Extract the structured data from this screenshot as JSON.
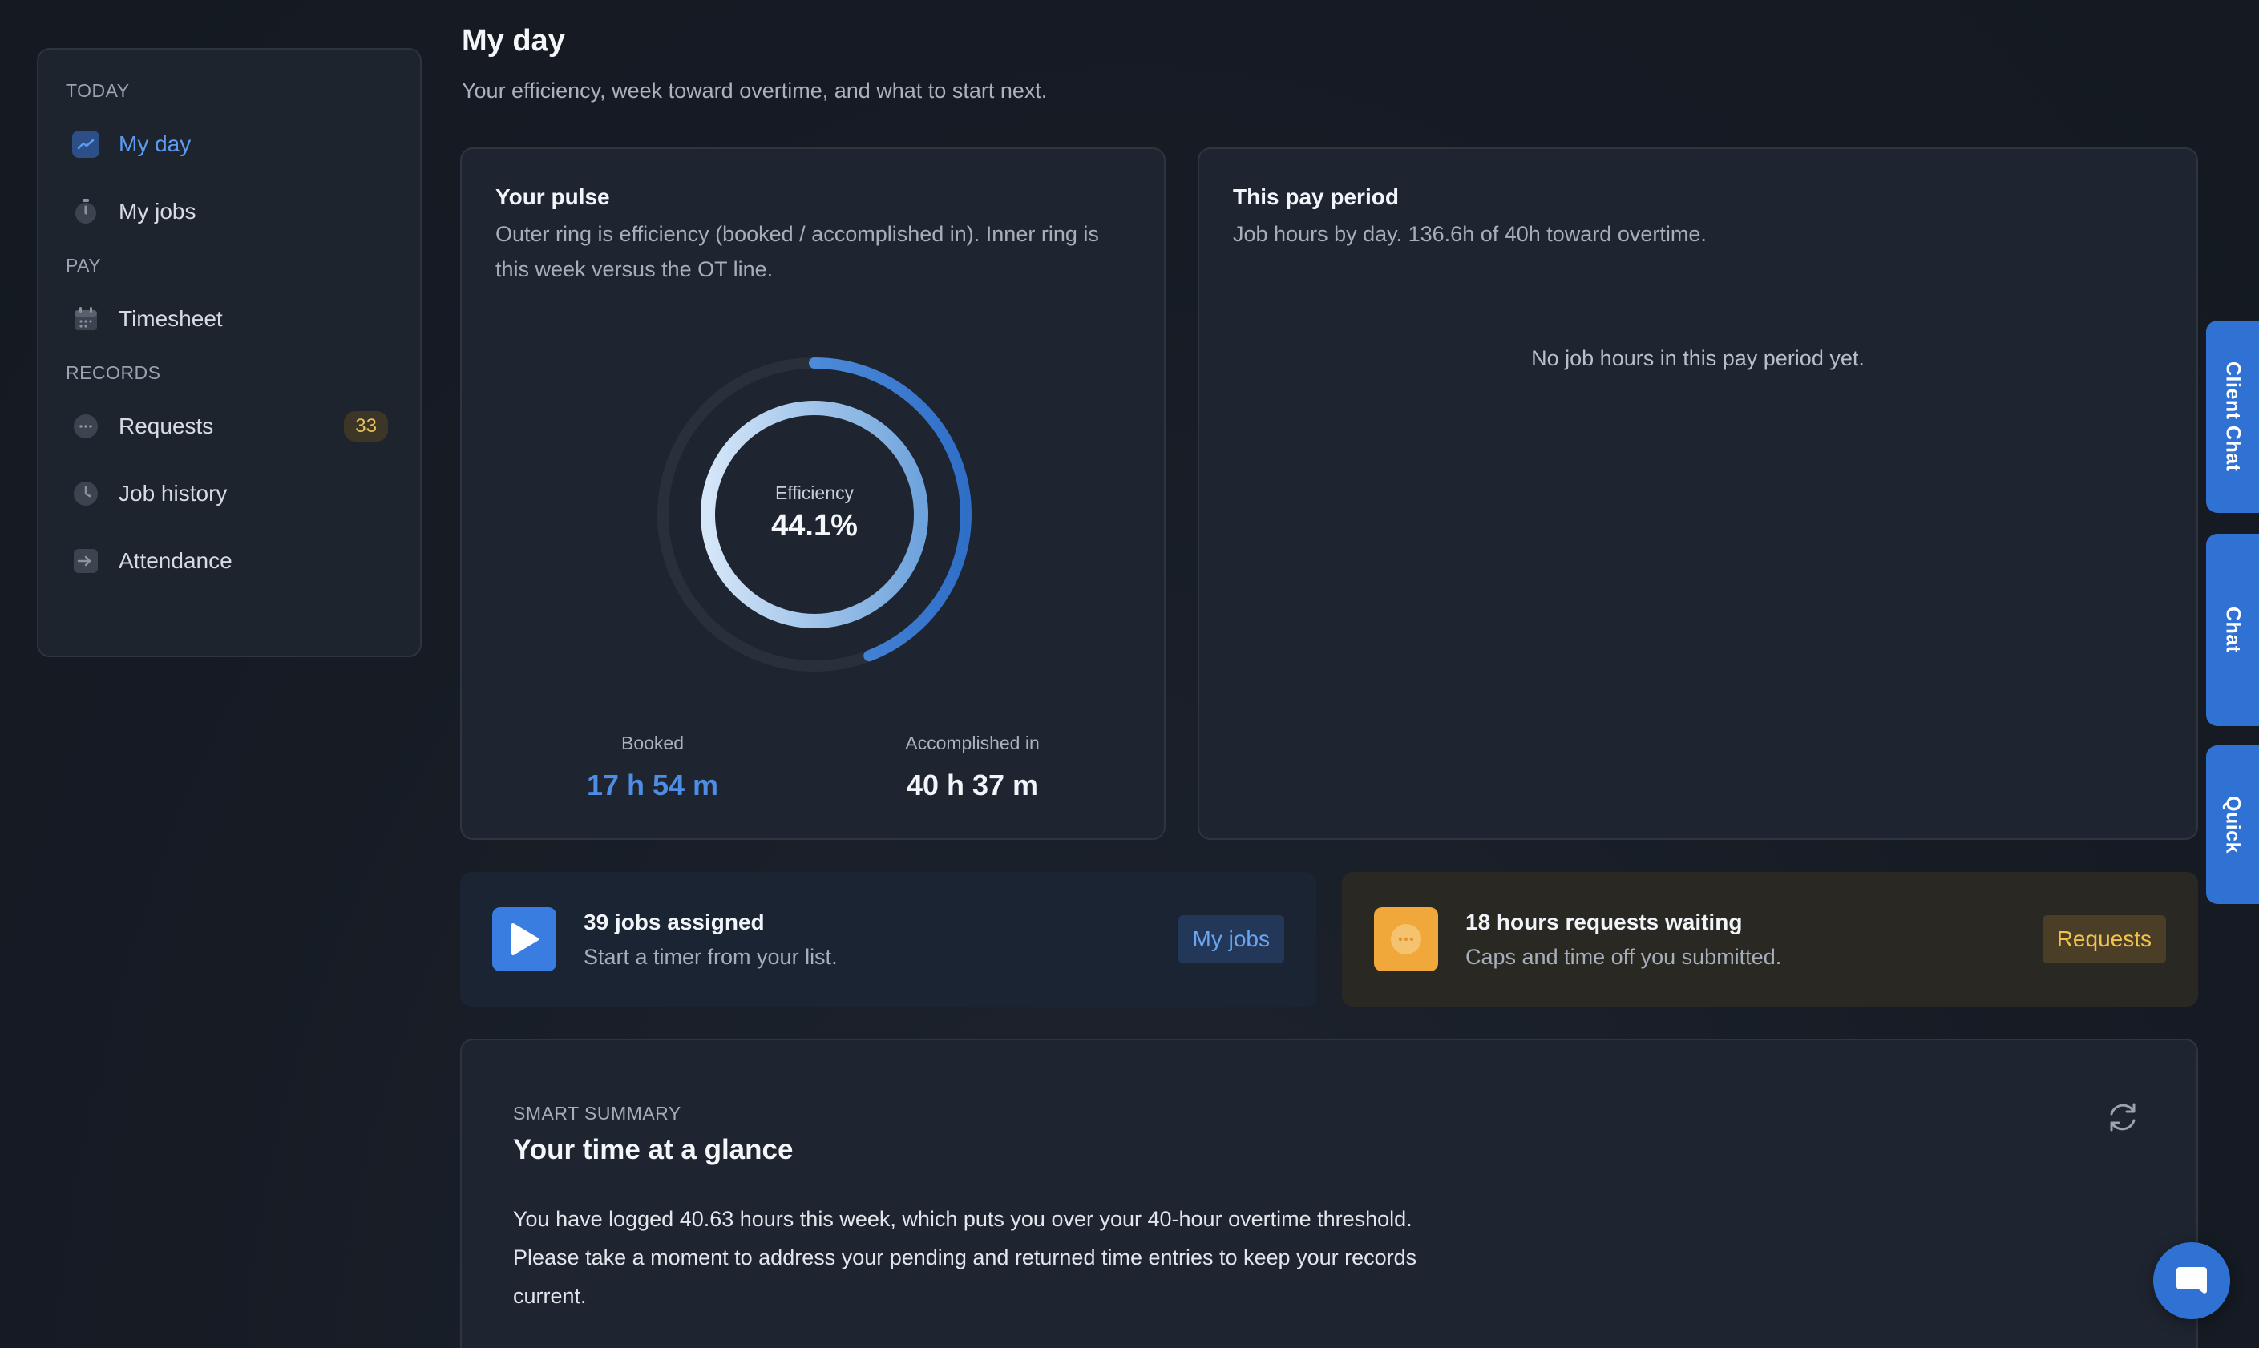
{
  "sidebar": {
    "sections": [
      {
        "title": "TODAY",
        "items": [
          {
            "label": "My day",
            "icon": "chart-icon",
            "active": true
          },
          {
            "label": "My jobs",
            "icon": "stopwatch-icon"
          }
        ]
      },
      {
        "title": "PAY",
        "items": [
          {
            "label": "Timesheet",
            "icon": "calendar-icon"
          }
        ]
      },
      {
        "title": "RECORDS",
        "items": [
          {
            "label": "Requests",
            "icon": "chat-bubble-icon",
            "badge": "33"
          },
          {
            "label": "Job history",
            "icon": "clock-icon"
          },
          {
            "label": "Attendance",
            "icon": "sign-in-icon"
          }
        ]
      }
    ]
  },
  "header": {
    "title": "My day",
    "subtitle": "Your efficiency, week toward overtime, and what to start next."
  },
  "pulse": {
    "title": "Your pulse",
    "description": "Outer ring is efficiency (booked / accomplished in). Inner ring is this week versus the OT line.",
    "efficiency_label": "Efficiency",
    "efficiency_value": "44.1%",
    "efficiency_fraction": 0.441,
    "inner_ring_fraction": 1.0,
    "booked_label": "Booked",
    "booked_value": "17 h 54 m",
    "accomplished_label": "Accomplished in",
    "accomplished_value": "40 h 37 m"
  },
  "pay_period": {
    "title": "This pay period",
    "description": "Job hours by day. 136.6h of 40h toward overtime.",
    "empty_message": "No job hours in this pay period yet."
  },
  "actions": {
    "jobs": {
      "title": "39 jobs assigned",
      "subtitle": "Start a timer from your list.",
      "button": "My jobs"
    },
    "requests": {
      "title": "18 hours requests waiting",
      "subtitle": "Caps and time off you submitted.",
      "button": "Requests"
    }
  },
  "summary": {
    "eyebrow": "SMART SUMMARY",
    "title": "Your time at a glance",
    "body": "You have logged 40.63 hours this week, which puts you over your 40-hour overtime threshold. Please take a moment to address your pending and returned time entries to keep your records current."
  },
  "side_tabs": {
    "client_chat": "Client Chat",
    "chat": "Chat",
    "quick": "Quick"
  },
  "colors": {
    "accent": "#3a7de0",
    "warning": "#f0a83a",
    "badge_text": "#e8c061"
  }
}
